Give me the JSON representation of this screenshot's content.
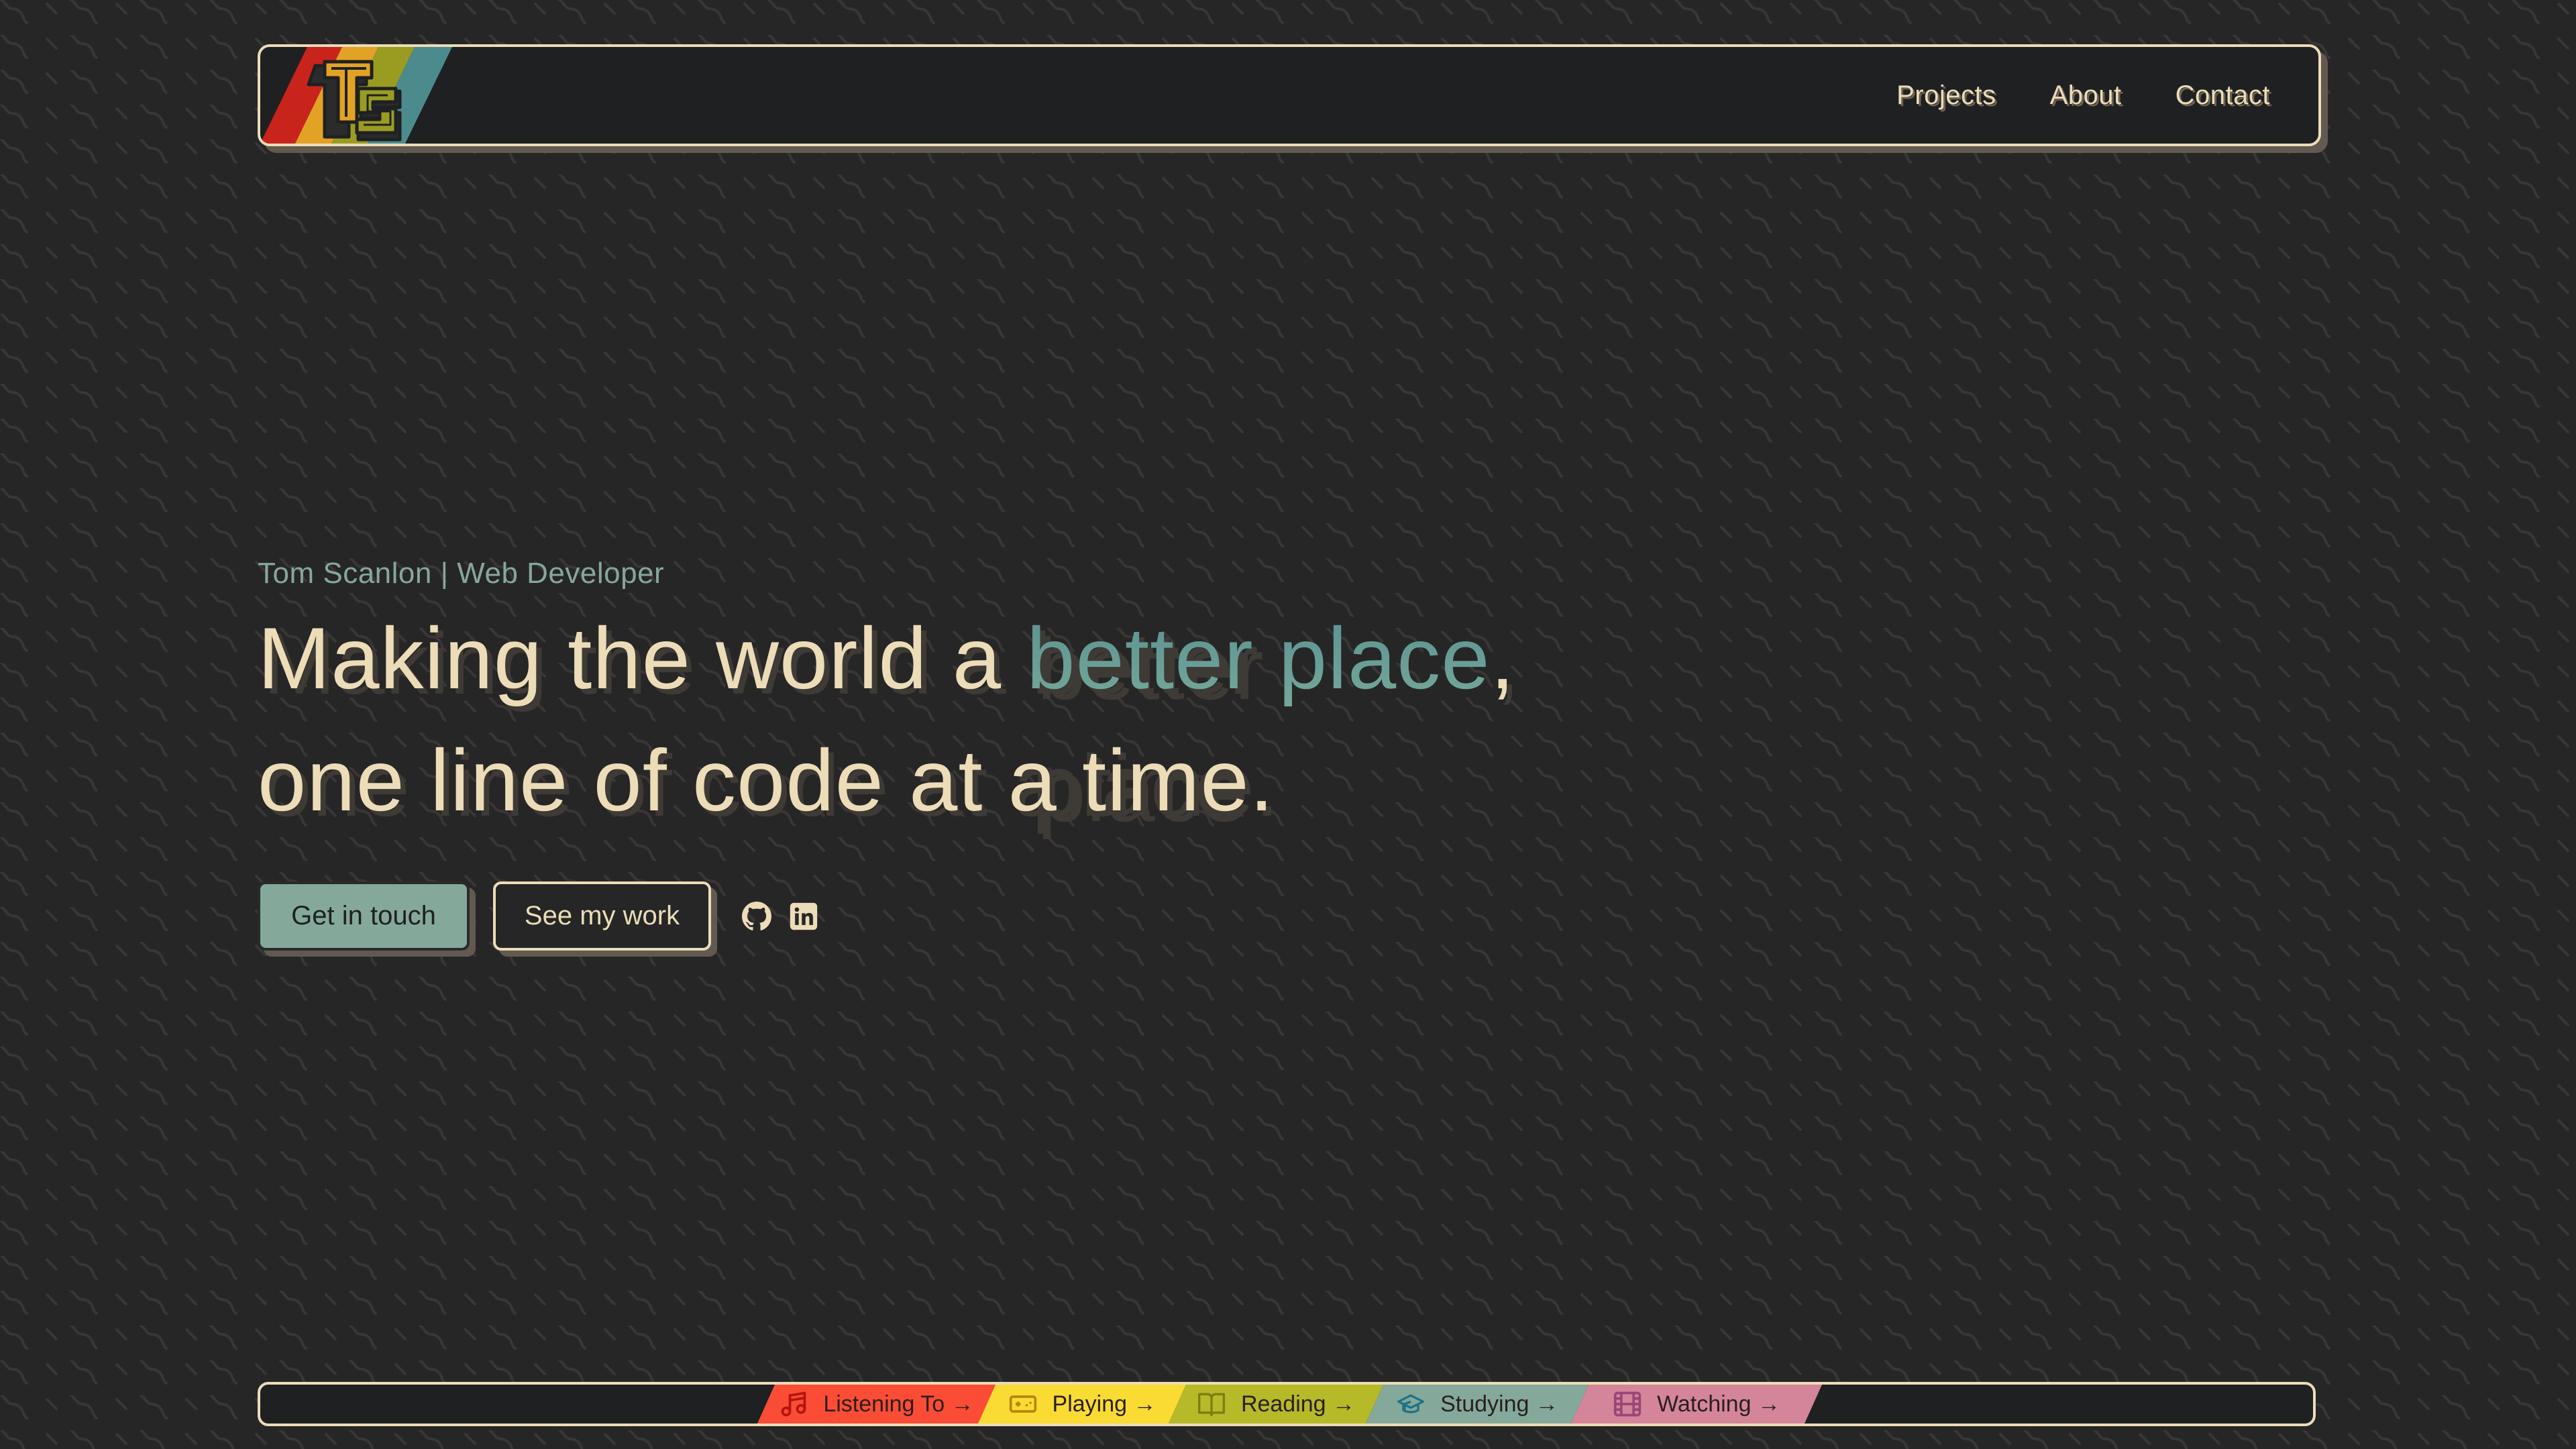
{
  "navbar": {
    "logo_alt": "TS",
    "logo_stripe_colors": [
      "#c9241c",
      "#e2a226",
      "#9a9c22",
      "#4c8b8d"
    ],
    "links": [
      {
        "label": "Projects"
      },
      {
        "label": "About"
      },
      {
        "label": "Contact"
      }
    ]
  },
  "hero": {
    "subtitle": "Tom Scanlon | Web Developer",
    "headline_part1": "Making the world a ",
    "headline_accent": "better place",
    "headline_part2": ",",
    "headline_line2": "one line of code at a time.",
    "primary_button": "Get in touch",
    "secondary_button": "See my work",
    "social": [
      {
        "name": "GitHub",
        "icon": "github-icon"
      },
      {
        "name": "LinkedIn",
        "icon": "linkedin-icon"
      }
    ]
  },
  "status_strip": {
    "items": [
      {
        "label": "Listening To →",
        "icon": "music-note-icon",
        "color": "#fb4c35",
        "icon_color": "#b3140f"
      },
      {
        "label": "Playing →",
        "icon": "gamepad-icon",
        "color": "#fadb33",
        "icon_color": "#b8860b"
      },
      {
        "label": "Reading →",
        "icon": "book-open-icon",
        "color": "#b6b928",
        "icon_color": "#7e7d10"
      },
      {
        "label": "Studying →",
        "icon": "graduation-cap-icon",
        "color": "#84a99a",
        "icon_color": "#1f7285"
      },
      {
        "label": "Watching →",
        "icon": "film-icon",
        "color": "#d4859a",
        "icon_color": "#9b4577"
      }
    ]
  },
  "colors": {
    "background": "#262626",
    "cream": "#ecdcb8",
    "accent_teal": "#5d9694",
    "sage": "#84a99a",
    "panel": "#1f2022",
    "shadow": "#625a50"
  }
}
